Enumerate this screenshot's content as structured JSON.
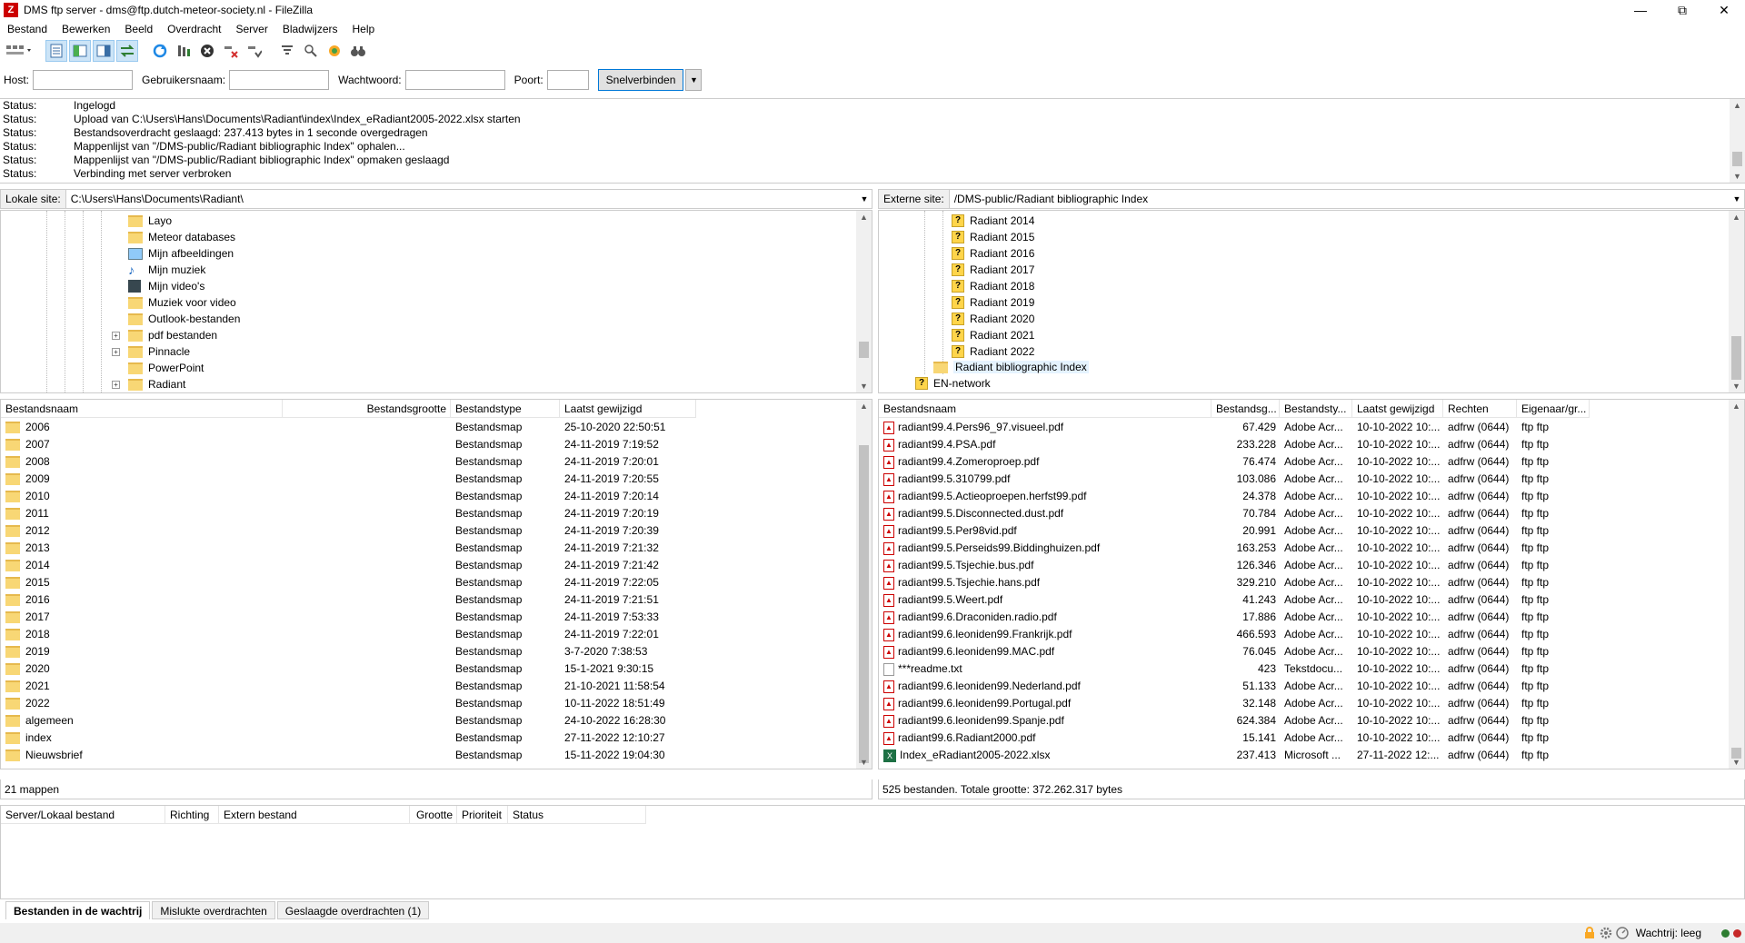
{
  "window": {
    "title": "DMS ftp server - dms@ftp.dutch-meteor-society.nl - FileZilla"
  },
  "menu": [
    "Bestand",
    "Bewerken",
    "Beeld",
    "Overdracht",
    "Server",
    "Bladwijzers",
    "Help"
  ],
  "quickconnect": {
    "host_label": "Host:",
    "host_value": "",
    "user_label": "Gebruikersnaam:",
    "user_value": "",
    "pass_label": "Wachtwoord:",
    "pass_value": "",
    "port_label": "Poort:",
    "port_value": "",
    "connect_label": "Snelverbinden"
  },
  "log": [
    {
      "k": "Status:",
      "v": "Ingelogd"
    },
    {
      "k": "Status:",
      "v": "Upload van C:\\Users\\Hans\\Documents\\Radiant\\index\\Index_eRadiant2005-2022.xlsx starten"
    },
    {
      "k": "Status:",
      "v": "Bestandsoverdracht geslaagd: 237.413 bytes in 1 seconde overgedragen"
    },
    {
      "k": "Status:",
      "v": "Mappenlijst van \"/DMS-public/Radiant bibliographic Index\" ophalen..."
    },
    {
      "k": "Status:",
      "v": "Mappenlijst van \"/DMS-public/Radiant bibliographic Index\" opmaken geslaagd"
    },
    {
      "k": "Status:",
      "v": "Verbinding met server verbroken"
    }
  ],
  "local": {
    "site_label": "Lokale site:",
    "path": "C:\\Users\\Hans\\Documents\\Radiant\\",
    "tree": [
      "Layo",
      "Meteor databases",
      "Mijn afbeeldingen",
      "Mijn muziek",
      "Mijn video's",
      "Muziek voor video",
      "Outlook-bestanden",
      "pdf bestanden",
      "Pinnacle",
      "PowerPoint",
      "Radiant"
    ],
    "columns": [
      "Bestandsnaam",
      "Bestandsgrootte",
      "Bestandstype",
      "Laatst gewijzigd"
    ],
    "files": [
      [
        "2006",
        "",
        "Bestandsmap",
        "25-10-2020 22:50:51"
      ],
      [
        "2007",
        "",
        "Bestandsmap",
        "24-11-2019 7:19:52"
      ],
      [
        "2008",
        "",
        "Bestandsmap",
        "24-11-2019 7:20:01"
      ],
      [
        "2009",
        "",
        "Bestandsmap",
        "24-11-2019 7:20:55"
      ],
      [
        "2010",
        "",
        "Bestandsmap",
        "24-11-2019 7:20:14"
      ],
      [
        "2011",
        "",
        "Bestandsmap",
        "24-11-2019 7:20:19"
      ],
      [
        "2012",
        "",
        "Bestandsmap",
        "24-11-2019 7:20:39"
      ],
      [
        "2013",
        "",
        "Bestandsmap",
        "24-11-2019 7:21:32"
      ],
      [
        "2014",
        "",
        "Bestandsmap",
        "24-11-2019 7:21:42"
      ],
      [
        "2015",
        "",
        "Bestandsmap",
        "24-11-2019 7:22:05"
      ],
      [
        "2016",
        "",
        "Bestandsmap",
        "24-11-2019 7:21:51"
      ],
      [
        "2017",
        "",
        "Bestandsmap",
        "24-11-2019 7:53:33"
      ],
      [
        "2018",
        "",
        "Bestandsmap",
        "24-11-2019 7:22:01"
      ],
      [
        "2019",
        "",
        "Bestandsmap",
        "3-7-2020 7:38:53"
      ],
      [
        "2020",
        "",
        "Bestandsmap",
        "15-1-2021 9:30:15"
      ],
      [
        "2021",
        "",
        "Bestandsmap",
        "21-10-2021 11:58:54"
      ],
      [
        "2022",
        "",
        "Bestandsmap",
        "10-11-2022 18:51:49"
      ],
      [
        "algemeen",
        "",
        "Bestandsmap",
        "24-10-2022 16:28:30"
      ],
      [
        "index",
        "",
        "Bestandsmap",
        "27-11-2022 12:10:27"
      ],
      [
        "Nieuwsbrief",
        "",
        "Bestandsmap",
        "15-11-2022 19:04:30"
      ]
    ],
    "status": "21 mappen"
  },
  "remote": {
    "site_label": "Externe site:",
    "path": "/DMS-public/Radiant bibliographic Index",
    "tree": [
      "Radiant 2014",
      "Radiant 2015",
      "Radiant 2016",
      "Radiant 2017",
      "Radiant 2018",
      "Radiant 2019",
      "Radiant 2020",
      "Radiant 2021",
      "Radiant 2022"
    ],
    "tree_parent": "Radiant bibliographic Index",
    "tree_network": "EN-network",
    "columns": [
      "Bestandsnaam",
      "Bestandsg...",
      "Bestandsty...",
      "Laatst gewijzigd",
      "Rechten",
      "Eigenaar/gr..."
    ],
    "files": [
      [
        "radiant99.4.Pers96_97.visueel.pdf",
        "67.429",
        "Adobe Acr...",
        "10-10-2022 10:...",
        "adfrw (0644)",
        "ftp ftp",
        "pdf"
      ],
      [
        "radiant99.4.PSA.pdf",
        "233.228",
        "Adobe Acr...",
        "10-10-2022 10:...",
        "adfrw (0644)",
        "ftp ftp",
        "pdf"
      ],
      [
        "radiant99.4.Zomeroproep.pdf",
        "76.474",
        "Adobe Acr...",
        "10-10-2022 10:...",
        "adfrw (0644)",
        "ftp ftp",
        "pdf"
      ],
      [
        "radiant99.5.310799.pdf",
        "103.086",
        "Adobe Acr...",
        "10-10-2022 10:...",
        "adfrw (0644)",
        "ftp ftp",
        "pdf"
      ],
      [
        "radiant99.5.Actieoproepen.herfst99.pdf",
        "24.378",
        "Adobe Acr...",
        "10-10-2022 10:...",
        "adfrw (0644)",
        "ftp ftp",
        "pdf"
      ],
      [
        "radiant99.5.Disconnected.dust.pdf",
        "70.784",
        "Adobe Acr...",
        "10-10-2022 10:...",
        "adfrw (0644)",
        "ftp ftp",
        "pdf"
      ],
      [
        "radiant99.5.Per98vid.pdf",
        "20.991",
        "Adobe Acr...",
        "10-10-2022 10:...",
        "adfrw (0644)",
        "ftp ftp",
        "pdf"
      ],
      [
        "radiant99.5.Perseids99.Biddinghuizen.pdf",
        "163.253",
        "Adobe Acr...",
        "10-10-2022 10:...",
        "adfrw (0644)",
        "ftp ftp",
        "pdf"
      ],
      [
        "radiant99.5.Tsjechie.bus.pdf",
        "126.346",
        "Adobe Acr...",
        "10-10-2022 10:...",
        "adfrw (0644)",
        "ftp ftp",
        "pdf"
      ],
      [
        "radiant99.5.Tsjechie.hans.pdf",
        "329.210",
        "Adobe Acr...",
        "10-10-2022 10:...",
        "adfrw (0644)",
        "ftp ftp",
        "pdf"
      ],
      [
        "radiant99.5.Weert.pdf",
        "41.243",
        "Adobe Acr...",
        "10-10-2022 10:...",
        "adfrw (0644)",
        "ftp ftp",
        "pdf"
      ],
      [
        "radiant99.6.Draconiden.radio.pdf",
        "17.886",
        "Adobe Acr...",
        "10-10-2022 10:...",
        "adfrw (0644)",
        "ftp ftp",
        "pdf"
      ],
      [
        "radiant99.6.leoniden99.Frankrijk.pdf",
        "466.593",
        "Adobe Acr...",
        "10-10-2022 10:...",
        "adfrw (0644)",
        "ftp ftp",
        "pdf"
      ],
      [
        "radiant99.6.leoniden99.MAC.pdf",
        "76.045",
        "Adobe Acr...",
        "10-10-2022 10:...",
        "adfrw (0644)",
        "ftp ftp",
        "pdf"
      ],
      [
        "***readme.txt",
        "423",
        "Tekstdocu...",
        "10-10-2022 10:...",
        "adfrw (0644)",
        "ftp ftp",
        "txt"
      ],
      [
        "radiant99.6.leoniden99.Nederland.pdf",
        "51.133",
        "Adobe Acr...",
        "10-10-2022 10:...",
        "adfrw (0644)",
        "ftp ftp",
        "pdf"
      ],
      [
        "radiant99.6.leoniden99.Portugal.pdf",
        "32.148",
        "Adobe Acr...",
        "10-10-2022 10:...",
        "adfrw (0644)",
        "ftp ftp",
        "pdf"
      ],
      [
        "radiant99.6.leoniden99.Spanje.pdf",
        "624.384",
        "Adobe Acr...",
        "10-10-2022 10:...",
        "adfrw (0644)",
        "ftp ftp",
        "pdf"
      ],
      [
        "radiant99.6.Radiant2000.pdf",
        "15.141",
        "Adobe Acr...",
        "10-10-2022 10:...",
        "adfrw (0644)",
        "ftp ftp",
        "pdf"
      ],
      [
        "Index_eRadiant2005-2022.xlsx",
        "237.413",
        "Microsoft ...",
        "27-11-2022 12:...",
        "adfrw (0644)",
        "ftp ftp",
        "xls"
      ]
    ],
    "status": "525 bestanden. Totale grootte: 372.262.317 bytes"
  },
  "queue": {
    "columns": [
      "Server/Lokaal bestand",
      "Richting",
      "Extern bestand",
      "Grootte",
      "Prioriteit",
      "Status"
    ]
  },
  "tabs": [
    "Bestanden in de wachtrij",
    "Mislukte overdrachten",
    "Geslaagde overdrachten (1)"
  ],
  "statusbar": {
    "queue": "Wachtrij: leeg"
  }
}
